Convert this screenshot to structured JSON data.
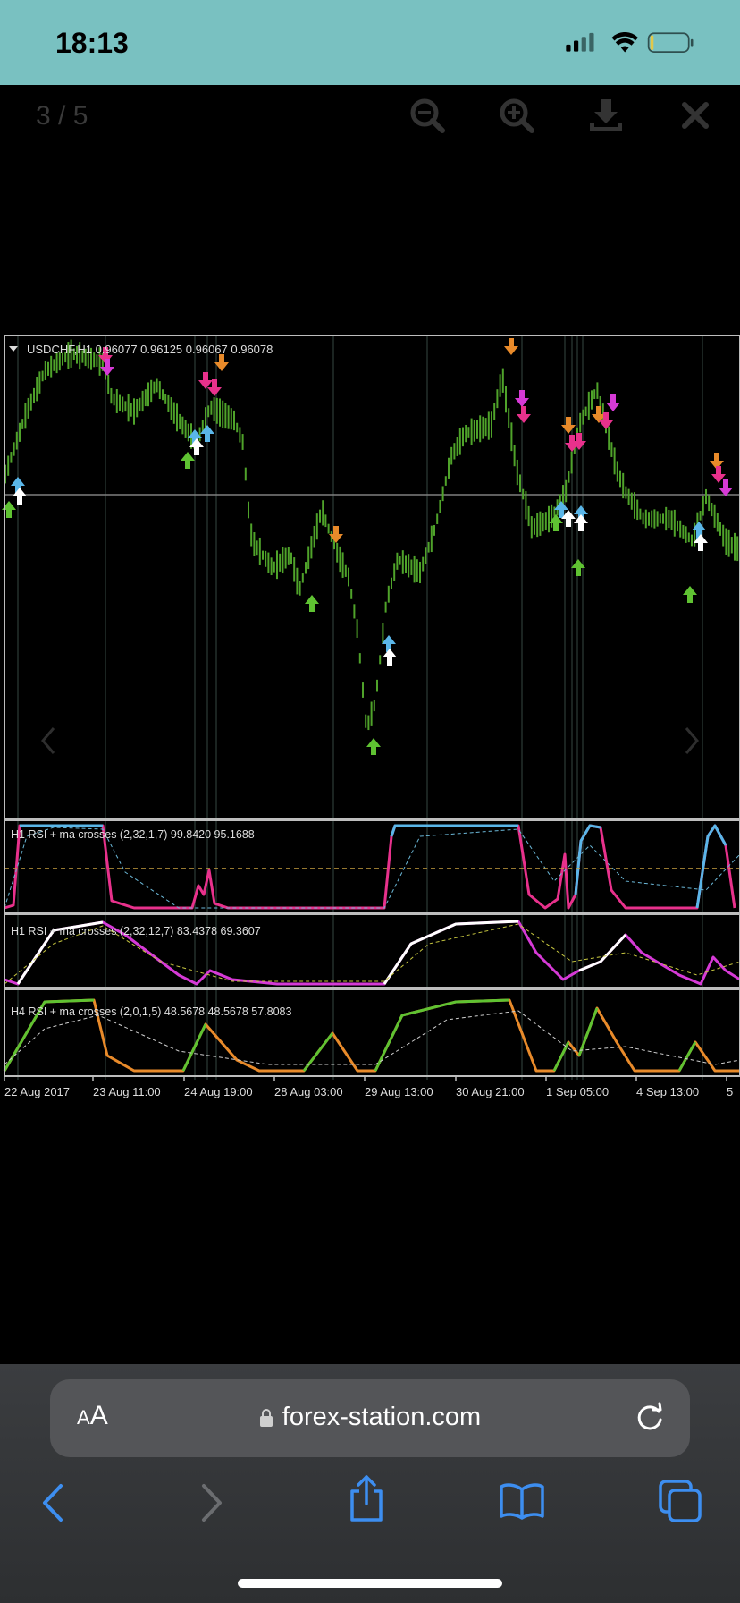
{
  "status_bar": {
    "time": "18:13"
  },
  "viewer": {
    "counter": "3 / 5",
    "icons": [
      "zoom-out-icon",
      "zoom-in-icon",
      "download-icon",
      "close-icon",
      "chevron-left-icon",
      "chevron-right-icon"
    ]
  },
  "chart": {
    "header": "USDCHF,H1  0.96077 0.96125 0.96067 0.96078",
    "panels": [
      {
        "label": "H1 RSI + ma crosses (2,32,1,7) 99.8420 95.1688"
      },
      {
        "label": "H1 RSI + ma crosses (2,32,12,7) 83.4378 69.3607"
      },
      {
        "label": "H4 RSI + ma crosses (2,0,1,5) 48.5678 48.5678 57.8083"
      }
    ],
    "x_labels": [
      "22 Aug 2017",
      "23 Aug 11:00",
      "24 Aug 19:00",
      "28 Aug 03:00",
      "29 Aug 13:00",
      "30 Aug 21:00",
      "1 Sep 05:00",
      "4 Sep 13:00",
      "5"
    ],
    "colors": {
      "price": "#4fa32a",
      "rsi_up": "#5ab6e8",
      "rsi_down": "#e8318c",
      "rsi2_up": "#ffffff",
      "rsi2_down": "#d63ad6",
      "rsi3_up": "#5fc232",
      "rsi3_down": "#e88a2a",
      "grid": "#7f7f7f"
    }
  },
  "browser": {
    "aa_small": "A",
    "aa_large": "A",
    "url": "forex-station.com"
  }
}
